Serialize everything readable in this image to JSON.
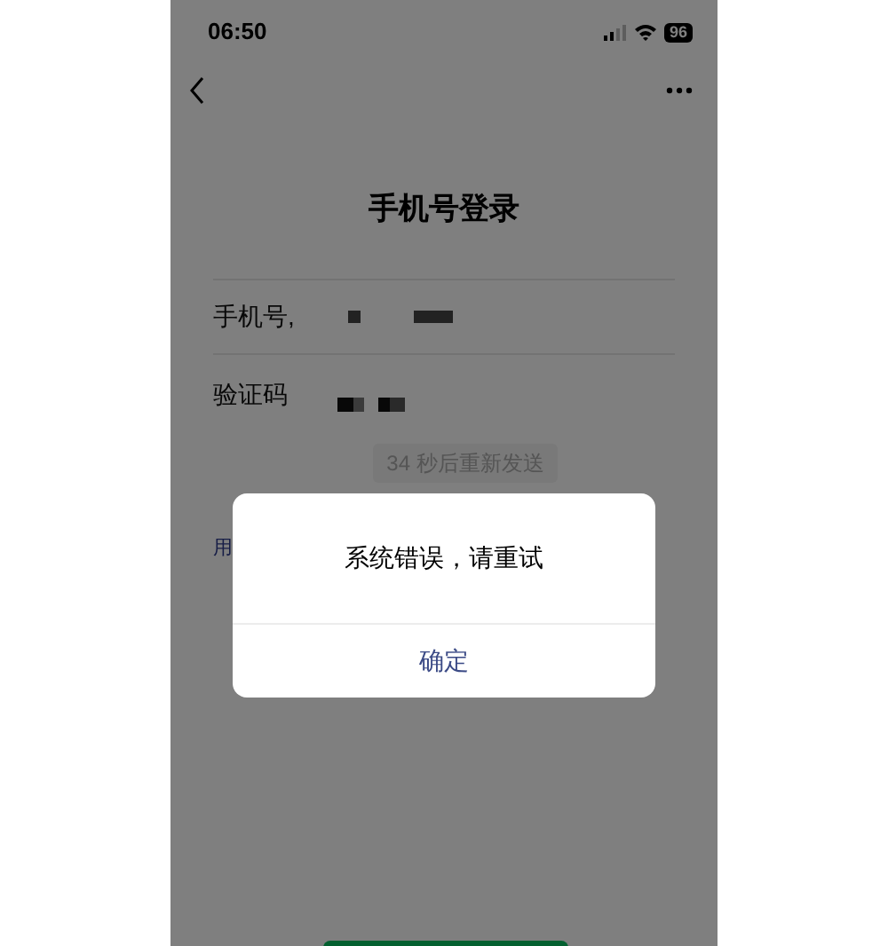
{
  "status_bar": {
    "time": "06:50",
    "battery": "96"
  },
  "page": {
    "title": "手机号登录",
    "fields": [
      {
        "label": "手机号,",
        "kind": "masked"
      },
      {
        "label": "验证码",
        "kind": "masked"
      }
    ],
    "resend_button": {
      "label": "34 秒后重新发送",
      "disabled": true
    },
    "agreement_link": "用"
  },
  "dialog": {
    "message": "系统错误，请重试",
    "buttons": [
      "确定"
    ]
  }
}
